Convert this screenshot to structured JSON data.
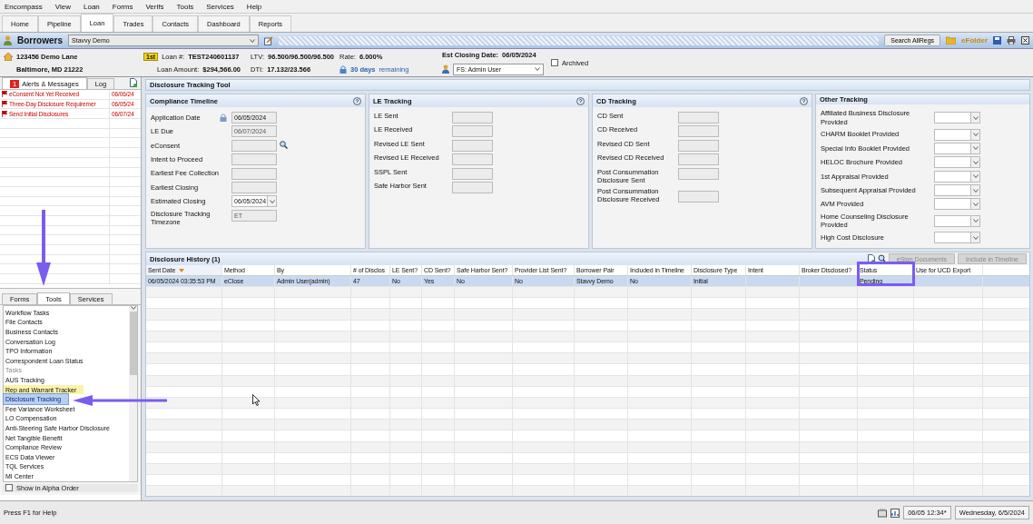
{
  "menu": [
    "Encompass",
    "View",
    "Loan",
    "Forms",
    "Verifs",
    "Tools",
    "Services",
    "Help"
  ],
  "tabs": [
    {
      "label": "Home",
      "selected": false
    },
    {
      "label": "Pipeline",
      "selected": false
    },
    {
      "label": "Loan",
      "selected": true
    },
    {
      "label": "Trades",
      "selected": false
    },
    {
      "label": "Contacts",
      "selected": false
    },
    {
      "label": "Dashboard",
      "selected": false
    },
    {
      "label": "Reports",
      "selected": false
    }
  ],
  "borrower_bar": {
    "title": "Borrowers",
    "borrower": "Stavvy Demo",
    "search_button": "Search AllRegs",
    "efolder": "eFolder"
  },
  "loan_info": {
    "address_1": "123456 Demo Lane",
    "address_2": "Baltimore, MD 21222",
    "lien_badge": "1st",
    "loan_number_label": "Loan #:",
    "loan_number": "TEST240601137",
    "loan_amount_label": "Loan Amount:",
    "loan_amount": "$294,566.00",
    "ltv_label": "LTV:",
    "ltv": "96.500/96.500/96.500",
    "dti_label": "DTI:",
    "dti": "17.132/23.566",
    "rate_label": "Rate:",
    "rate": "6.000%",
    "days": "30 days",
    "days_suffix": "remaining",
    "est_closing_label": "Est Closing Date:",
    "est_closing": "06/05/2024",
    "user": "FS: Admin User",
    "archived": {
      "label": "Archived",
      "checked": false
    }
  },
  "alerts_panel": {
    "tabs": [
      {
        "label": "Alerts & Messages",
        "badge": "1",
        "selected": true
      },
      {
        "label": "Log",
        "selected": false
      }
    ],
    "items": [
      {
        "text": "eConsent Not Yet Received",
        "date": "06/06/24"
      },
      {
        "text": "Three-Day Disclosure Requiremer",
        "date": "06/05/24"
      },
      {
        "text": "Send Initial Disclosures",
        "date": "06/07/24"
      }
    ]
  },
  "tools_panel": {
    "tabs": [
      {
        "label": "Forms",
        "selected": false
      },
      {
        "label": "Tools",
        "selected": true
      },
      {
        "label": "Services",
        "selected": false
      }
    ],
    "items": [
      {
        "label": "Workflow Tasks",
        "kind": "item",
        "selected": false,
        "highlighted": false
      },
      {
        "label": "File Contacts",
        "kind": "item",
        "selected": false,
        "highlighted": false
      },
      {
        "label": "Business Contacts",
        "kind": "item",
        "selected": false,
        "highlighted": false
      },
      {
        "label": "Conversation Log",
        "kind": "item",
        "selected": false,
        "highlighted": false
      },
      {
        "label": "TPO Information",
        "kind": "item",
        "selected": false,
        "highlighted": false
      },
      {
        "label": "Correspondent Loan Status",
        "kind": "item",
        "selected": false,
        "highlighted": false
      },
      {
        "label": "Tasks",
        "kind": "section",
        "selected": false,
        "highlighted": false
      },
      {
        "label": "AUS Tracking",
        "kind": "item",
        "selected": false,
        "highlighted": false
      },
      {
        "label": "Rep and Warrant Tracker",
        "kind": "item",
        "selected": false,
        "highlighted": true
      },
      {
        "label": "Disclosure Tracking",
        "kind": "item",
        "selected": true,
        "highlighted": false
      },
      {
        "label": "Fee Variance Worksheet",
        "kind": "item",
        "selected": false,
        "highlighted": false
      },
      {
        "label": "LO Compensation",
        "kind": "item",
        "selected": false,
        "highlighted": false
      },
      {
        "label": "Anti-Steering Safe Harbor Disclosure",
        "kind": "item",
        "selected": false,
        "highlighted": false
      },
      {
        "label": "Net Tangible Benefit",
        "kind": "item",
        "selected": false,
        "highlighted": false
      },
      {
        "label": "Compliance Review",
        "kind": "item",
        "selected": false,
        "highlighted": false
      },
      {
        "label": "ECS Data Viewer",
        "kind": "item",
        "selected": false,
        "highlighted": false
      },
      {
        "label": "TQL Services",
        "kind": "item",
        "selected": false,
        "highlighted": false
      },
      {
        "label": "MI Center",
        "kind": "item",
        "selected": false,
        "highlighted": false
      }
    ],
    "alpha_order": {
      "label": "Show in Alpha Order",
      "checked": false
    }
  },
  "tool": {
    "title": "Disclosure Tracking Tool",
    "compliance_timeline": {
      "title": "Compliance Timeline",
      "fields": [
        {
          "label": "Application Date",
          "value": "06/05/2024",
          "kind": "locked"
        },
        {
          "label": "LE Due",
          "value": "06/07/2024",
          "kind": "plain"
        },
        {
          "label": "eConsent",
          "kind": "lookup"
        },
        {
          "label": "Intent to Proceed",
          "kind": "plain"
        },
        {
          "label": "Earliest Fee Collection",
          "kind": "plain"
        },
        {
          "label": "Earliest Closing",
          "kind": "plain"
        },
        {
          "label": "Estimated Closing",
          "value": "06/05/2024",
          "kind": "dropdown"
        },
        {
          "label": "Disclosure Tracking Timezone",
          "value": "ET",
          "kind": "plain"
        }
      ]
    },
    "le_tracking": {
      "title": "LE Tracking",
      "fields": [
        {
          "label": "LE Sent"
        },
        {
          "label": "LE Received"
        },
        {
          "label": "Revised LE Sent"
        },
        {
          "label": "Revised LE Received"
        },
        {
          "label": "SSPL Sent"
        },
        {
          "label": "Safe Harbor Sent"
        }
      ]
    },
    "cd_tracking": {
      "title": "CD Tracking",
      "fields": [
        {
          "label": "CD Sent"
        },
        {
          "label": "CD Received"
        },
        {
          "label": "Revised CD Sent"
        },
        {
          "label": "Revised CD Received"
        },
        {
          "label": "Post Consummation Disclosure Sent"
        },
        {
          "label": "Post Consummation Disclosure Received"
        }
      ]
    },
    "other_tracking": {
      "title": "Other Tracking",
      "fields": [
        {
          "label": "Affiliated Business Disclosure Provided"
        },
        {
          "label": "CHARM Booklet Provided"
        },
        {
          "label": "Special Info Booklet Provided"
        },
        {
          "label": "HELOC Brochure Provided"
        },
        {
          "label": "1st Appraisal Provided"
        },
        {
          "label": "Subsequent Appraisal Provided"
        },
        {
          "label": "AVM Provided"
        },
        {
          "label": "Home Counseling Disclosure Provided"
        },
        {
          "label": "High Cost Disclosure"
        }
      ]
    },
    "history": {
      "title": "Disclosure History (1)",
      "buttons": [
        {
          "label": "eSign Documents",
          "disabled": true
        },
        {
          "label": "Include in Timeline",
          "disabled": true
        }
      ],
      "columns": [
        {
          "label": "Sent Date",
          "sorted": true
        },
        {
          "label": "Method",
          "sorted": false
        },
        {
          "label": "By",
          "sorted": false
        },
        {
          "label": "# of Disclos",
          "sorted": false
        },
        {
          "label": "LE Sent?",
          "sorted": false
        },
        {
          "label": "CD Sent?",
          "sorted": false
        },
        {
          "label": "Safe Harbor Sent?",
          "sorted": false
        },
        {
          "label": "Provider List Sent?",
          "sorted": false
        },
        {
          "label": "Borrower Pair",
          "sorted": false
        },
        {
          "label": "Included in Timeline",
          "sorted": false
        },
        {
          "label": "Disclosure Type",
          "sorted": false
        },
        {
          "label": "Intent",
          "sorted": false
        },
        {
          "label": "Broker Disclosed?",
          "sorted": false
        },
        {
          "label": "Status",
          "sorted": false
        },
        {
          "label": "Use for UCD Export",
          "sorted": false
        }
      ],
      "rows": [
        {
          "selected": true,
          "cells": [
            "06/05/2024 03:35:53 PM",
            "eClose",
            "Admin User(admin)",
            "47",
            "No",
            "Yes",
            "No",
            "No",
            "Stavvy Demo",
            "No",
            "Initial",
            "",
            "",
            "Pending",
            ""
          ]
        }
      ]
    }
  },
  "status_bar": {
    "help": "Press F1 for Help",
    "time": "06/05 12:34*",
    "date": "Wednesday, 6/5/2024"
  }
}
